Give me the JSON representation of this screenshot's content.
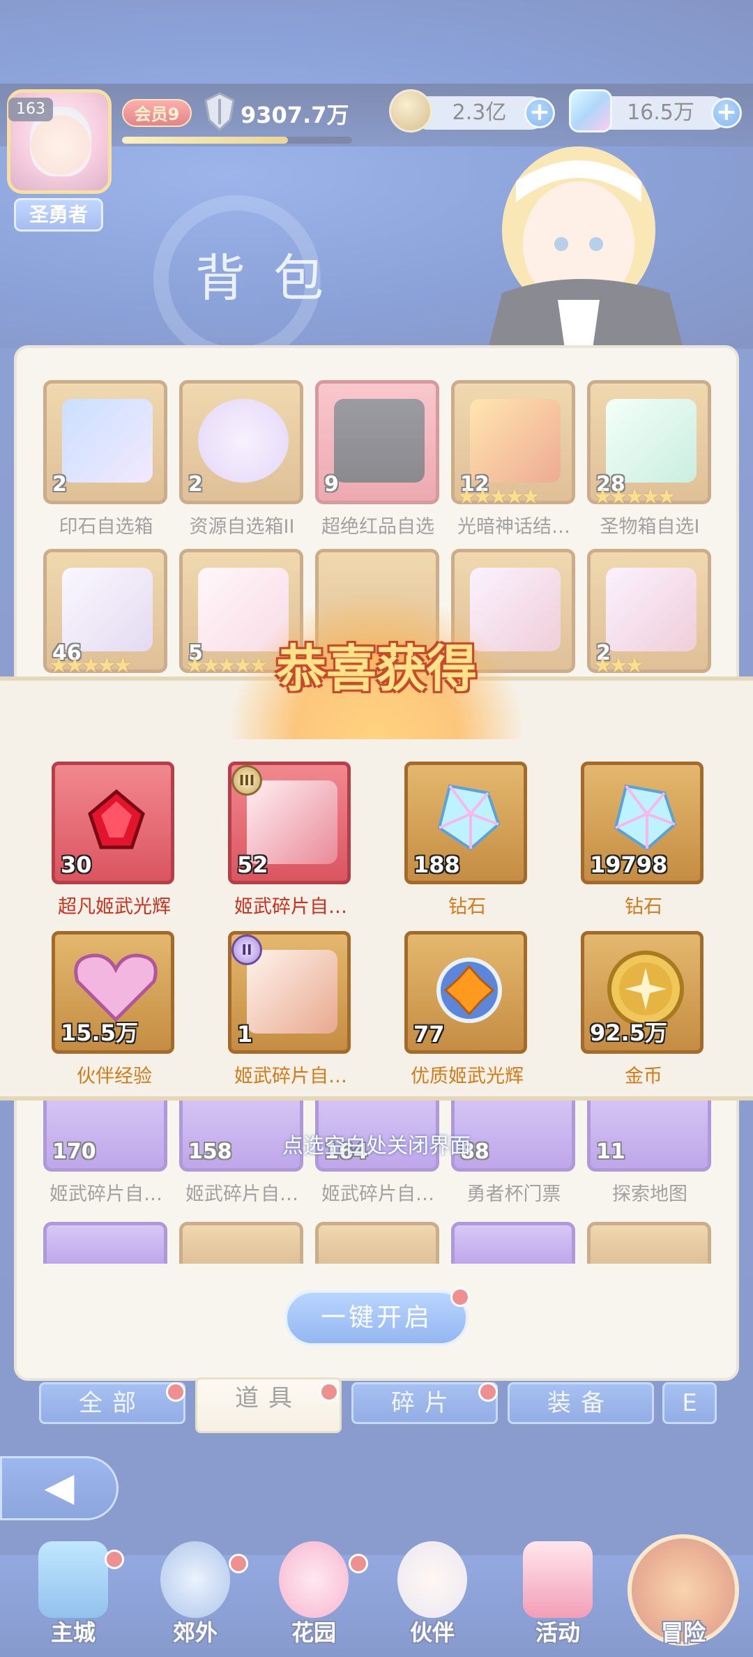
{
  "header": {
    "level": "163",
    "title_tag": "圣勇者",
    "vip": "会员9",
    "power": "9307.7万",
    "exp_progress": 0.72,
    "gold": "2.3亿",
    "diamonds": "16.5万",
    "page_title": "背包"
  },
  "inventory": {
    "row1": [
      {
        "count": "2",
        "label": "印石自选箱",
        "style": "gold"
      },
      {
        "count": "2",
        "label": "资源自选箱II",
        "style": "gold"
      },
      {
        "count": "9",
        "label": "超绝红品自选",
        "style": "red"
      },
      {
        "count": "12",
        "label": "光暗神话结…",
        "style": "gold",
        "stars": "★★★★★"
      },
      {
        "count": "28",
        "label": "圣物箱自选I",
        "style": "gold",
        "stars": "★★★★★"
      }
    ],
    "row2": [
      {
        "count": "46",
        "stars": "★★★★★"
      },
      {
        "count": "5",
        "stars": "★★★★★"
      },
      {
        "count": ""
      },
      {
        "count": ""
      },
      {
        "count": "2",
        "stars": "★★★"
      }
    ],
    "row5": [
      {
        "count": "170",
        "label": "姬武碎片自…",
        "style": "purple"
      },
      {
        "count": "158",
        "label": "姬武碎片自…",
        "style": "purple"
      },
      {
        "count": "164",
        "label": "姬武碎片自…",
        "style": "purple"
      },
      {
        "count": "88",
        "label": "勇者杯门票",
        "style": "purple"
      },
      {
        "count": "11",
        "label": "探索地图",
        "style": "purple"
      }
    ]
  },
  "reward": {
    "title": "恭喜获得",
    "items": [
      {
        "count": "30",
        "label": "超凡姬武光辉",
        "style": "red",
        "label_color": "#c8321e"
      },
      {
        "count": "52",
        "label": "姬武碎片自…",
        "style": "red",
        "label_color": "#c8321e",
        "rank": "III"
      },
      {
        "count": "188",
        "label": "钻石",
        "style": "gold",
        "label_color": "#d27b18"
      },
      {
        "count": "19798",
        "label": "钻石",
        "style": "gold",
        "label_color": "#d27b18"
      },
      {
        "count": "15.5万",
        "label": "伙伴经验",
        "style": "gold",
        "label_color": "#d27b18"
      },
      {
        "count": "1",
        "label": "姬武碎片自…",
        "style": "gold",
        "label_color": "#d27b18",
        "rank": "II"
      },
      {
        "count": "77",
        "label": "优质姬武光辉",
        "style": "gold",
        "label_color": "#d27b18"
      },
      {
        "count": "92.5万",
        "label": "金币",
        "style": "gold",
        "label_color": "#d27b18"
      }
    ],
    "close_hint": "点选空白处关闭界面"
  },
  "open_all": "一键开启",
  "tabs": [
    "全部",
    "道具",
    "碎片",
    "装备",
    "E"
  ],
  "active_tab": "道具",
  "back": "◀",
  "nav": [
    "主城",
    "郊外",
    "花园",
    "伙伴",
    "活动",
    "冒险"
  ]
}
